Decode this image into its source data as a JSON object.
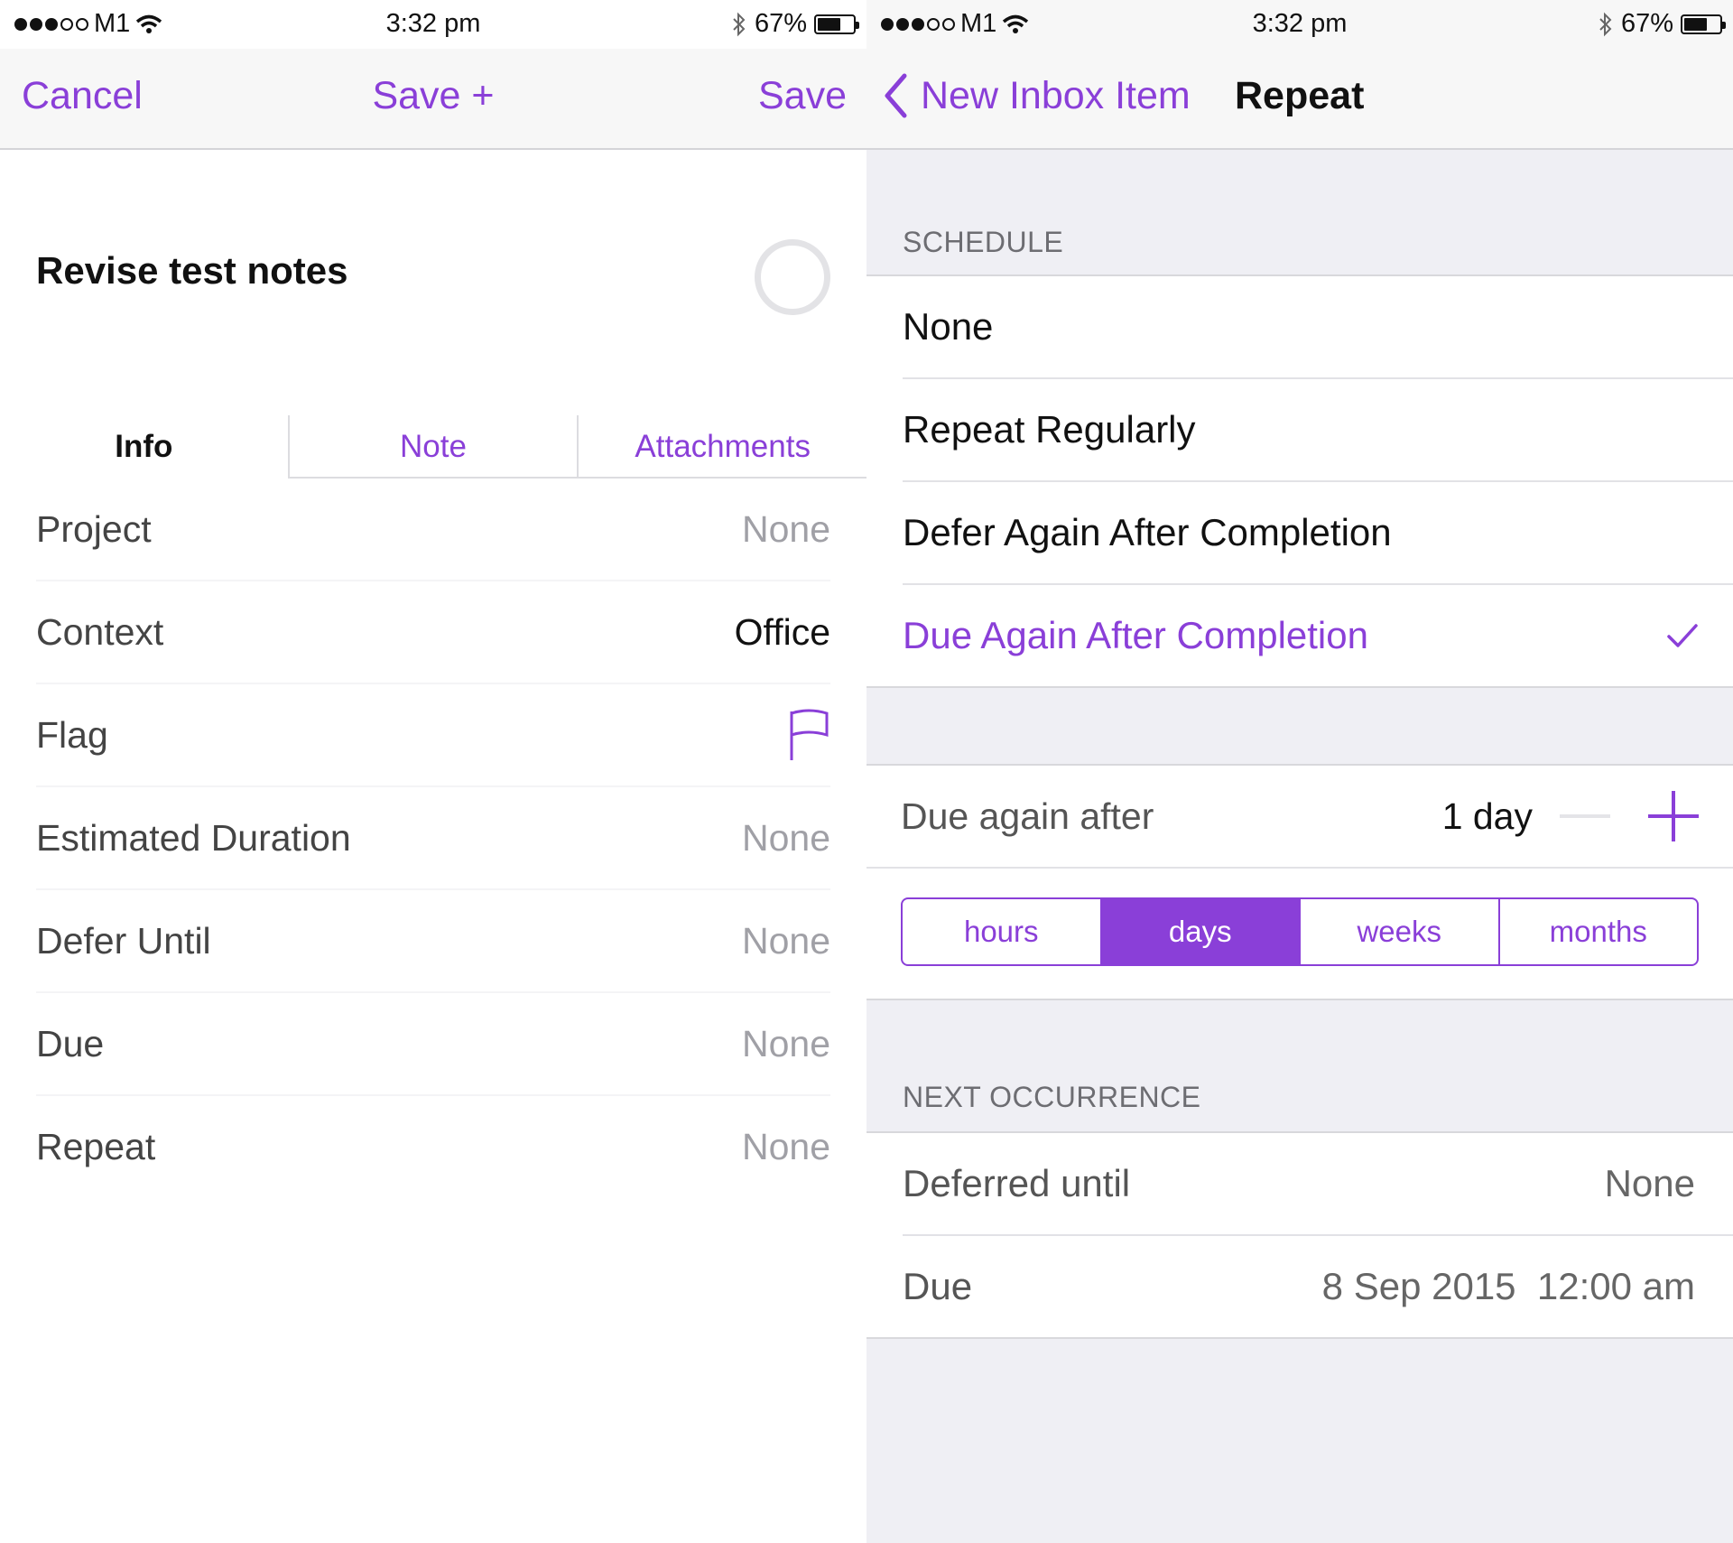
{
  "status_bar": {
    "carrier": "M1",
    "time": "3:32 pm",
    "battery": "67%",
    "battery_level": 0.67
  },
  "left": {
    "nav": {
      "cancel": "Cancel",
      "save_plus": "Save +",
      "save": "Save"
    },
    "title": "Revise test notes",
    "tabs": [
      "Info",
      "Note",
      "Attachments"
    ],
    "active_tab": "Info",
    "rows": [
      {
        "label": "Project",
        "value": "None"
      },
      {
        "label": "Context",
        "value": "Office"
      },
      {
        "label": "Flag",
        "icon": "flag-icon"
      },
      {
        "label": "Estimated Duration",
        "value": "None"
      },
      {
        "label": "Defer Until",
        "value": "None"
      },
      {
        "label": "Due",
        "value": "None"
      },
      {
        "label": "Repeat",
        "value": "None"
      }
    ]
  },
  "right": {
    "nav": {
      "back": "New Inbox Item",
      "title": "Repeat"
    },
    "schedule_header": "SCHEDULE",
    "schedule_options": [
      "None",
      "Repeat Regularly",
      "Defer Again After Completion",
      "Due Again After Completion"
    ],
    "selected_option": "Due Again After Completion",
    "due_again": {
      "label": "Due again after",
      "value": "1 day"
    },
    "units": [
      "hours",
      "days",
      "weeks",
      "months"
    ],
    "selected_unit": "days",
    "next_header": "NEXT OCCURRENCE",
    "next": [
      {
        "label": "Deferred until",
        "value": "None"
      },
      {
        "label": "Due",
        "value": "8 Sep 2015  12:00 am"
      }
    ]
  },
  "colors": {
    "accent": "#8a3fd8",
    "grouped_background": "#efeff4",
    "separator": "#e2e2e6"
  }
}
